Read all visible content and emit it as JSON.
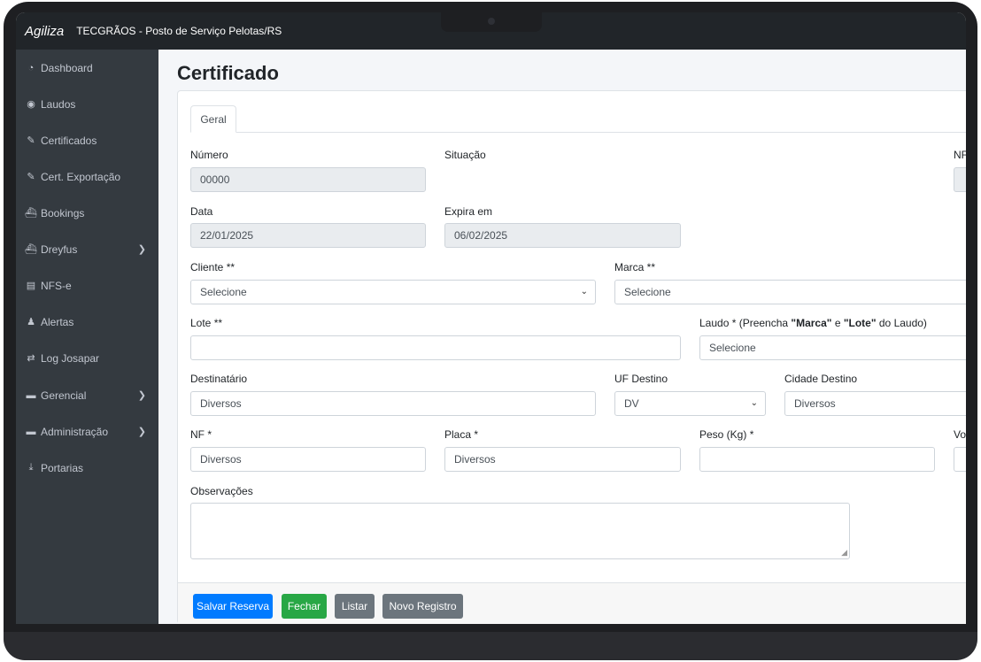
{
  "app": {
    "brand": "Agiliza",
    "company": "TECGRÃOS - Posto de Serviço Pelotas/RS"
  },
  "sidebar": {
    "items": [
      {
        "label": "Dashboard",
        "icon": "tachometer-icon",
        "glyph": "◔",
        "has_submenu": false
      },
      {
        "label": "Laudos",
        "icon": "eye-icon",
        "glyph": "◉",
        "has_submenu": false
      },
      {
        "label": "Certificados",
        "icon": "edit-icon",
        "glyph": "✎",
        "has_submenu": false
      },
      {
        "label": "Cert. Exportação",
        "icon": "edit-icon",
        "glyph": "✎",
        "has_submenu": false
      },
      {
        "label": "Bookings",
        "icon": "ship-icon",
        "glyph": "⛴",
        "has_submenu": false
      },
      {
        "label": "Dreyfus",
        "icon": "ship-icon",
        "glyph": "⛴",
        "has_submenu": true
      },
      {
        "label": "NFS-e",
        "icon": "document-icon",
        "glyph": "▤",
        "has_submenu": false
      },
      {
        "label": "Alertas",
        "icon": "bell-icon",
        "glyph": "♟",
        "has_submenu": false
      },
      {
        "label": "Log Josapar",
        "icon": "exchange-icon",
        "glyph": "⇄",
        "has_submenu": false
      },
      {
        "label": "Gerencial",
        "icon": "folder-icon",
        "glyph": "▬",
        "has_submenu": true
      },
      {
        "label": "Administração",
        "icon": "folder-icon",
        "glyph": "▬",
        "has_submenu": true
      },
      {
        "label": "Portarias",
        "icon": "download-icon",
        "glyph": "⤓",
        "has_submenu": false
      }
    ]
  },
  "page": {
    "title": "Certificado",
    "tab_geral": "Geral"
  },
  "form": {
    "numero_label": "Número",
    "numero_value": "00000",
    "situacao_label": "Situação",
    "nf_partial_label": "NF",
    "data_label": "Data",
    "data_value": "22/01/2025",
    "expira_label": "Expira em",
    "expira_value": "06/02/2025",
    "cliente_label": "Cliente **",
    "cliente_value": "Selecione",
    "marca_label": "Marca **",
    "marca_value": "Selecione",
    "lote_label": "Lote **",
    "lote_value": "",
    "laudo_label_prefix": "Laudo * (Preencha ",
    "laudo_label_marca": "\"Marca\"",
    "laudo_label_e": " e ",
    "laudo_label_lote": "\"Lote\"",
    "laudo_label_suffix": " do Laudo)",
    "laudo_value": "Selecione",
    "destinatario_label": "Destinatário",
    "destinatario_value": "Diversos",
    "uf_label": "UF Destino",
    "uf_value": "DV",
    "cidade_label": "Cidade Destino",
    "cidade_value": "Diversos",
    "nf_label": "NF *",
    "nf_value": "Diversos",
    "placa_label": "Placa *",
    "placa_value": "Diversos",
    "peso_label": "Peso (Kg) *",
    "peso_value": "",
    "vol_partial_label": "Vol",
    "observacoes_label": "Observações"
  },
  "buttons": {
    "salvar": "Salvar Reserva",
    "fechar": "Fechar",
    "listar": "Listar",
    "novo": "Novo Registro"
  },
  "colors": {
    "primary": "#007bff",
    "success": "#28a745",
    "secondary": "#6c757d",
    "sidebar": "#343a40",
    "navbar": "#212529"
  }
}
